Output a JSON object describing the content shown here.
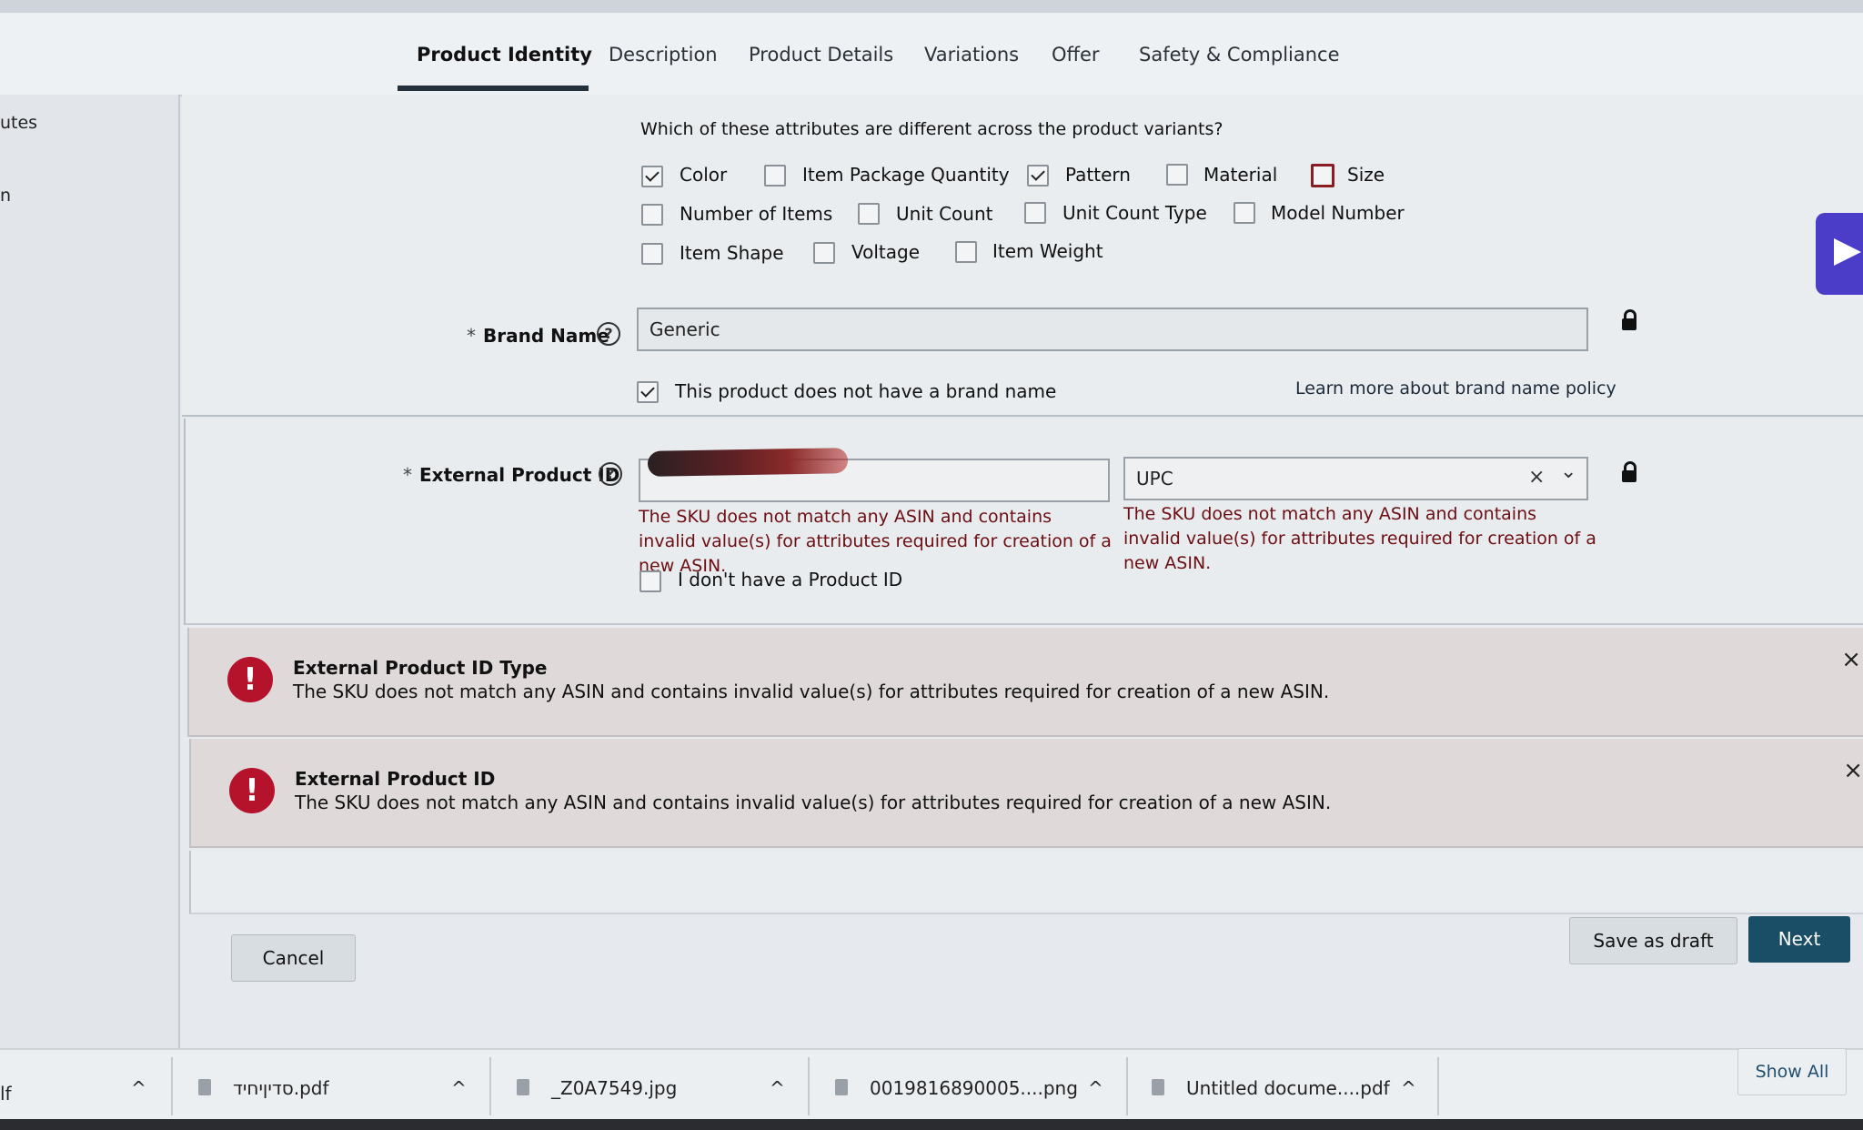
{
  "tabs": [
    {
      "label": "Product Identity",
      "active": true
    },
    {
      "label": "Description",
      "active": false
    },
    {
      "label": "Product Details",
      "active": false
    },
    {
      "label": "Variations",
      "active": false
    },
    {
      "label": "Offer",
      "active": false
    },
    {
      "label": "Safety & Compliance",
      "active": false
    }
  ],
  "left_panel": {
    "fragment_1": "utes",
    "fragment_2": "n"
  },
  "variations": {
    "question": "Which of these attributes are different across the product variants?",
    "attributes": [
      {
        "label": "Color",
        "checked": true
      },
      {
        "label": "Item Package Quantity",
        "checked": false
      },
      {
        "label": "Pattern",
        "checked": true
      },
      {
        "label": "Material",
        "checked": false
      },
      {
        "label": "Size",
        "checked": false
      },
      {
        "label": "Number of Items",
        "checked": false
      },
      {
        "label": "Unit Count",
        "checked": false
      },
      {
        "label": "Unit Count Type",
        "checked": false
      },
      {
        "label": "Model Number",
        "checked": false
      },
      {
        "label": "Item Shape",
        "checked": false
      },
      {
        "label": "Voltage",
        "checked": false
      },
      {
        "label": "Item Weight",
        "checked": false
      }
    ]
  },
  "brand": {
    "required_mark": "*",
    "label": "Brand Name",
    "value": "Generic",
    "no_brand_label": "This product does not have a brand name",
    "no_brand_checked": true,
    "policy_link": "Learn more about brand name policy"
  },
  "external_id": {
    "required_mark": "*",
    "label": "External Product ID",
    "type_value": "UPC",
    "error": "The SKU does not match any ASIN and contains invalid value(s) for attributes required for creation of a new ASIN.",
    "no_id_label": "I don't have a Product ID",
    "no_id_checked": false
  },
  "alerts": [
    {
      "title": "External Product ID Type",
      "text": "The SKU does not match any ASIN and contains invalid value(s) for attributes required for creation of a new ASIN."
    },
    {
      "title": "External Product ID",
      "text": "The SKU does not match any ASIN and contains invalid value(s) for attributes required for creation of a new ASIN."
    }
  ],
  "actions": {
    "cancel": "Cancel",
    "save_draft": "Save as draft",
    "next": "Next"
  },
  "downloads": {
    "fragment": "lf",
    "items": [
      {
        "name": "סדיןיחיד.pdf"
      },
      {
        "name": "_Z0A7549.jpg"
      },
      {
        "name": "0019816890005....png"
      },
      {
        "name": "Untitled docume....pdf"
      }
    ],
    "show_all": "Show All"
  },
  "icons": {
    "help": "?",
    "close": "×",
    "chevron": "⌄",
    "caret_up": "^",
    "alert": "!"
  },
  "colors": {
    "primary": "#1a4e66",
    "error": "#b5122b",
    "error_text": "#6c0e12",
    "sidebar_accent": "#4b3dc8"
  }
}
